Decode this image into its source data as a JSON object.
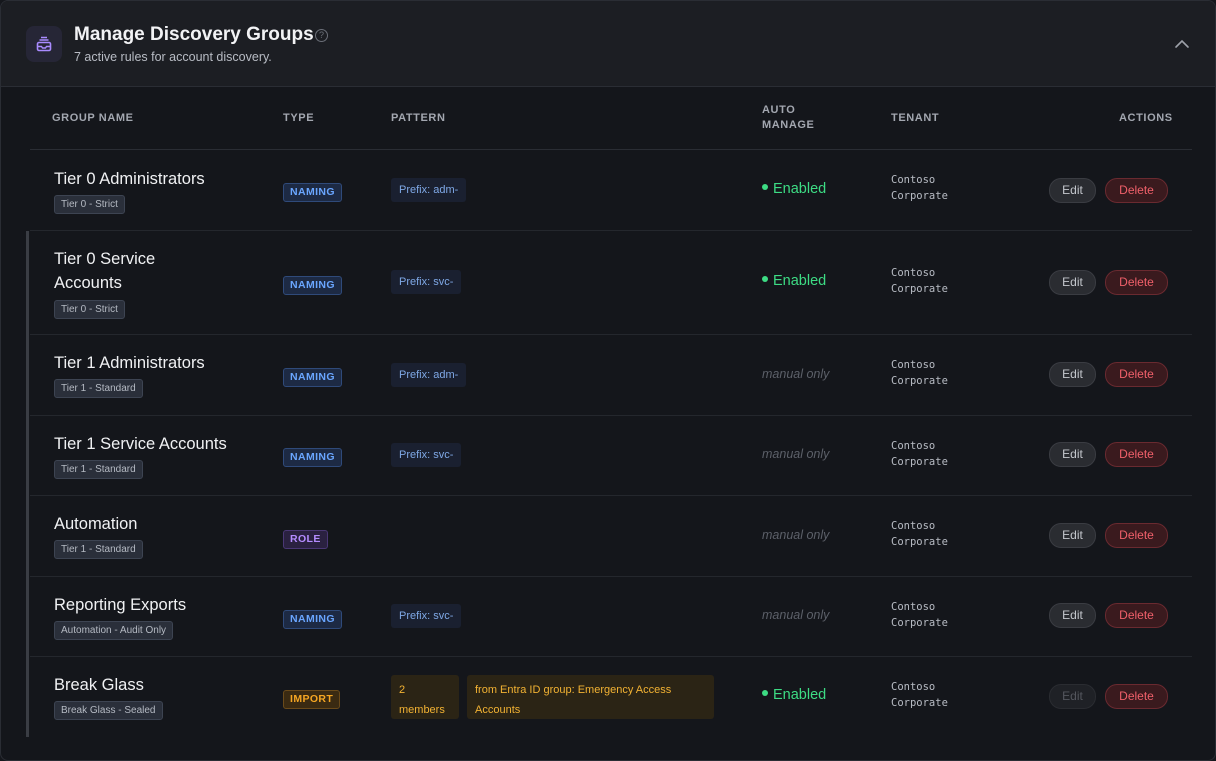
{
  "header": {
    "title": "Manage Discovery Groups",
    "subtitle": "7 active rules for account discovery.",
    "help_icon": "question-circle-icon",
    "collapse_icon": "chevron-up-icon",
    "app_icon": "inbox-stack-icon"
  },
  "table": {
    "columns": {
      "group_name": "GROUP NAME",
      "type": "TYPE",
      "pattern": "PATTERN",
      "auto_manage_1": "AUTO",
      "auto_manage_2": "MANAGE",
      "tenant": "TENANT",
      "actions": "ACTIONS"
    },
    "rows": [
      {
        "name": "Tier 0 Administrators",
        "policy": "Tier 0 - Strict",
        "type": "NAMING",
        "pattern": "Prefix: adm-",
        "auto": "Enabled",
        "tenant1": "Contoso",
        "tenant2": "Corporate",
        "edit": "Edit",
        "delete": "Delete"
      },
      {
        "name1": "Tier 0 Service",
        "name2": "Accounts",
        "policy": "Tier 0 - Strict",
        "type": "NAMING",
        "pattern": "Prefix: svc-",
        "auto": "Enabled",
        "tenant1": "Contoso",
        "tenant2": "Corporate",
        "edit": "Edit",
        "delete": "Delete"
      },
      {
        "name": "Tier 1 Administrators",
        "policy": "Tier 1 - Standard",
        "type": "NAMING",
        "pattern": "Prefix: adm-",
        "auto": "manual only",
        "tenant1": "Contoso",
        "tenant2": "Corporate",
        "edit": "Edit",
        "delete": "Delete"
      },
      {
        "name": "Tier 1 Service Accounts",
        "policy": "Tier 1 - Standard",
        "type": "NAMING",
        "pattern": "Prefix: svc-",
        "auto": "manual only",
        "tenant1": "Contoso",
        "tenant2": "Corporate",
        "edit": "Edit",
        "delete": "Delete"
      },
      {
        "name": "Automation",
        "policy": "Tier 1 - Standard",
        "type": "ROLE",
        "pattern": "",
        "auto": "manual only",
        "tenant1": "Contoso",
        "tenant2": "Corporate",
        "edit": "Edit",
        "delete": "Delete"
      },
      {
        "name": "Reporting Exports",
        "policy": "Automation - Audit Only",
        "type": "NAMING",
        "pattern": "Prefix: svc-",
        "auto": "manual only",
        "tenant1": "Contoso",
        "tenant2": "Corporate",
        "edit": "Edit",
        "delete": "Delete"
      },
      {
        "name": "Break Glass",
        "policy": "Break Glass - Sealed",
        "type": "IMPORT",
        "members1": "2",
        "members2": "members",
        "source1": "from Entra ID group: Emergency Access",
        "source2": "Accounts",
        "auto": "Enabled",
        "tenant1": "Contoso",
        "tenant2": "Corporate",
        "edit": "Edit",
        "delete": "Delete"
      }
    ]
  },
  "colors": {
    "enabled": "#3ddc84",
    "naming": "#6aa6ff",
    "role": "#b48cff",
    "import": "#f5a623",
    "delete": "#f0606a"
  }
}
